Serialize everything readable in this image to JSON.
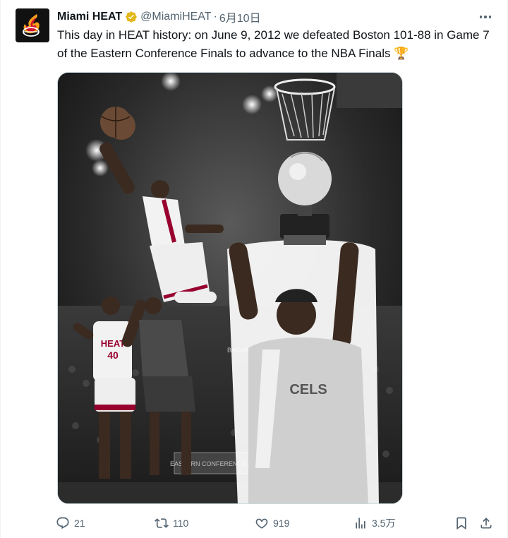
{
  "author": {
    "display_name": "Miami HEAT",
    "handle": "@MiamiHEAT",
    "separator": "·",
    "date": "6月10日"
  },
  "tweet": {
    "text": "This day in HEAT history: on June 9, 2012 we defeated Boston 101-88 in Game 7 of the Eastern Conference Finals to advance to the NBA Finals",
    "emoji": "🏆"
  },
  "media": {
    "jersey_team": "HEAT",
    "jersey_number": "40",
    "shirt_text": "CELS",
    "banner_text": "EASTERN CONFERENCE FINALS",
    "arena_text": "BACARDI"
  },
  "actions": {
    "replies": "21",
    "reposts": "110",
    "likes": "919",
    "views": "3.5万"
  },
  "colors": {
    "accent_gold": "#f4a600",
    "heat_red": "#98002e",
    "text_secondary": "#536471"
  }
}
